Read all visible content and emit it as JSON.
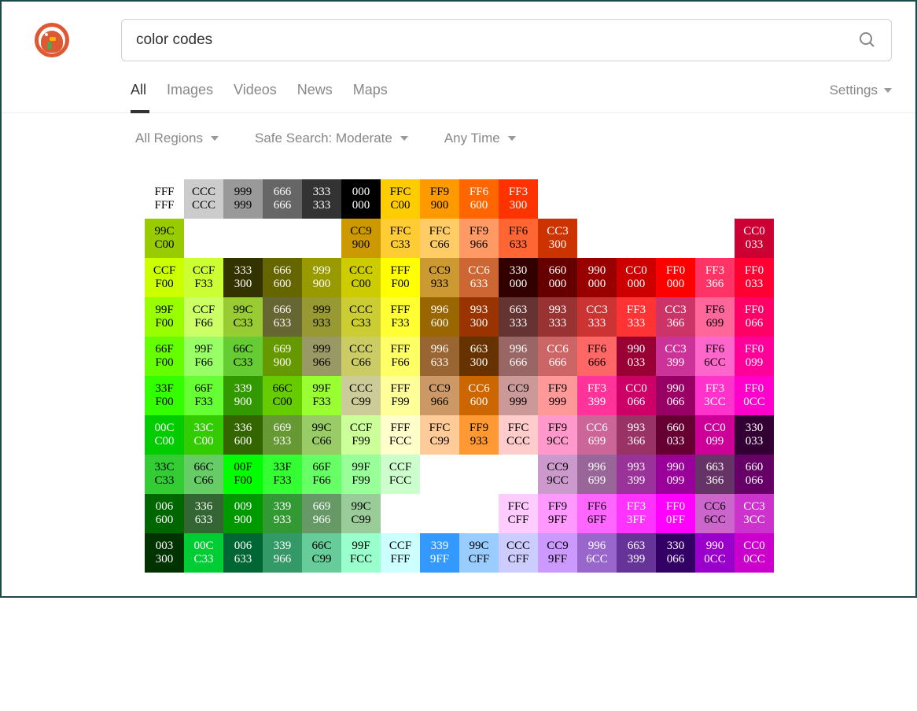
{
  "search": {
    "query": "color codes"
  },
  "tabs": [
    "All",
    "Images",
    "Videos",
    "News",
    "Maps"
  ],
  "active_tab": "All",
  "settings_label": "Settings",
  "filters": {
    "region": "All Regions",
    "safe": "Safe Search: Moderate",
    "time": "Any Time"
  },
  "grid": [
    [
      [
        "FFF",
        "FFF"
      ],
      [
        "CCC",
        "CCC"
      ],
      [
        "999",
        "999"
      ],
      [
        "666",
        "666"
      ],
      [
        "333",
        "333"
      ],
      [
        "000",
        "000"
      ],
      [
        "FFC",
        "C00"
      ],
      [
        "FF9",
        "900"
      ],
      [
        "FF6",
        "600"
      ],
      [
        "FF3",
        "300"
      ],
      null,
      null,
      null,
      null,
      null,
      null
    ],
    [
      [
        "99C",
        "C00"
      ],
      null,
      null,
      null,
      null,
      [
        "CC9",
        "900"
      ],
      [
        "FFC",
        "C33"
      ],
      [
        "FFC",
        "C66"
      ],
      [
        "FF9",
        "966"
      ],
      [
        "FF6",
        "633"
      ],
      [
        "CC3",
        "300"
      ],
      null,
      null,
      null,
      null,
      [
        "CC0",
        "033"
      ]
    ],
    [
      [
        "CCF",
        "F00"
      ],
      [
        "CCF",
        "F33"
      ],
      [
        "333",
        "300"
      ],
      [
        "666",
        "600"
      ],
      [
        "999",
        "900"
      ],
      [
        "CCC",
        "C00"
      ],
      [
        "FFF",
        "F00"
      ],
      [
        "CC9",
        "933"
      ],
      [
        "CC6",
        "633"
      ],
      [
        "330",
        "000"
      ],
      [
        "660",
        "000"
      ],
      [
        "990",
        "000"
      ],
      [
        "CC0",
        "000"
      ],
      [
        "FF0",
        "000"
      ],
      [
        "FF3",
        "366"
      ],
      [
        "FF0",
        "033"
      ]
    ],
    [
      [
        "99F",
        "F00"
      ],
      [
        "CCF",
        "F66"
      ],
      [
        "99C",
        "C33"
      ],
      [
        "666",
        "633"
      ],
      [
        "999",
        "933"
      ],
      [
        "CCC",
        "C33"
      ],
      [
        "FFF",
        "F33"
      ],
      [
        "996",
        "600"
      ],
      [
        "993",
        "300"
      ],
      [
        "663",
        "333"
      ],
      [
        "993",
        "333"
      ],
      [
        "CC3",
        "333"
      ],
      [
        "FF3",
        "333"
      ],
      [
        "CC3",
        "366"
      ],
      [
        "FF6",
        "699"
      ],
      [
        "FF0",
        "066"
      ]
    ],
    [
      [
        "66F",
        "F00"
      ],
      [
        "99F",
        "F66"
      ],
      [
        "66C",
        "C33"
      ],
      [
        "669",
        "900"
      ],
      [
        "999",
        "966"
      ],
      [
        "CCC",
        "C66"
      ],
      [
        "FFF",
        "F66"
      ],
      [
        "996",
        "633"
      ],
      [
        "663",
        "300"
      ],
      [
        "996",
        "666"
      ],
      [
        "CC6",
        "666"
      ],
      [
        "FF6",
        "666"
      ],
      [
        "990",
        "033"
      ],
      [
        "CC3",
        "399"
      ],
      [
        "FF6",
        "6CC"
      ],
      [
        "FF0",
        "099"
      ]
    ],
    [
      [
        "33F",
        "F00"
      ],
      [
        "66F",
        "F33"
      ],
      [
        "339",
        "900"
      ],
      [
        "66C",
        "C00"
      ],
      [
        "99F",
        "F33"
      ],
      [
        "CCC",
        "C99"
      ],
      [
        "FFF",
        "F99"
      ],
      [
        "CC9",
        "966"
      ],
      [
        "CC6",
        "600"
      ],
      [
        "CC9",
        "999"
      ],
      [
        "FF9",
        "999"
      ],
      [
        "FF3",
        "399"
      ],
      [
        "CC0",
        "066"
      ],
      [
        "990",
        "066"
      ],
      [
        "FF3",
        "3CC"
      ],
      [
        "FF0",
        "0CC"
      ]
    ],
    [
      [
        "00C",
        "C00"
      ],
      [
        "33C",
        "C00"
      ],
      [
        "336",
        "600"
      ],
      [
        "669",
        "933"
      ],
      [
        "99C",
        "C66"
      ],
      [
        "CCF",
        "F99"
      ],
      [
        "FFF",
        "FCC"
      ],
      [
        "FFC",
        "C99"
      ],
      [
        "FF9",
        "933"
      ],
      [
        "FFC",
        "CCC"
      ],
      [
        "FF9",
        "9CC"
      ],
      [
        "CC6",
        "699"
      ],
      [
        "993",
        "366"
      ],
      [
        "660",
        "033"
      ],
      [
        "CC0",
        "099"
      ],
      [
        "330",
        "033"
      ]
    ],
    [
      [
        "33C",
        "C33"
      ],
      [
        "66C",
        "C66"
      ],
      [
        "00F",
        "F00"
      ],
      [
        "33F",
        "F33"
      ],
      [
        "66F",
        "F66"
      ],
      [
        "99F",
        "F99"
      ],
      [
        "CCF",
        "FCC"
      ],
      null,
      null,
      null,
      [
        "CC9",
        "9CC"
      ],
      [
        "996",
        "699"
      ],
      [
        "993",
        "399"
      ],
      [
        "990",
        "099"
      ],
      [
        "663",
        "366"
      ],
      [
        "660",
        "066"
      ]
    ],
    [
      [
        "006",
        "600"
      ],
      [
        "336",
        "633"
      ],
      [
        "009",
        "900"
      ],
      [
        "339",
        "933"
      ],
      [
        "669",
        "966"
      ],
      [
        "99C",
        "C99"
      ],
      null,
      null,
      null,
      [
        "FFC",
        "CFF"
      ],
      [
        "FF9",
        "9FF"
      ],
      [
        "FF6",
        "6FF"
      ],
      [
        "FF3",
        "3FF"
      ],
      [
        "FF0",
        "0FF"
      ],
      [
        "CC6",
        "6CC"
      ],
      [
        "CC3",
        "3CC"
      ]
    ],
    [
      [
        "003",
        "300"
      ],
      [
        "00C",
        "C33"
      ],
      [
        "006",
        "633"
      ],
      [
        "339",
        "966"
      ],
      [
        "66C",
        "C99"
      ],
      [
        "99F",
        "FCC"
      ],
      [
        "CCF",
        "FFF"
      ],
      [
        "339",
        "9FF"
      ],
      [
        "99C",
        "CFF"
      ],
      [
        "CCC",
        "CFF"
      ],
      [
        "CC9",
        "9FF"
      ],
      [
        "996",
        "6CC"
      ],
      [
        "663",
        "399"
      ],
      [
        "330",
        "066"
      ],
      [
        "990",
        "0CC"
      ],
      [
        "CC0",
        "0CC"
      ]
    ]
  ]
}
